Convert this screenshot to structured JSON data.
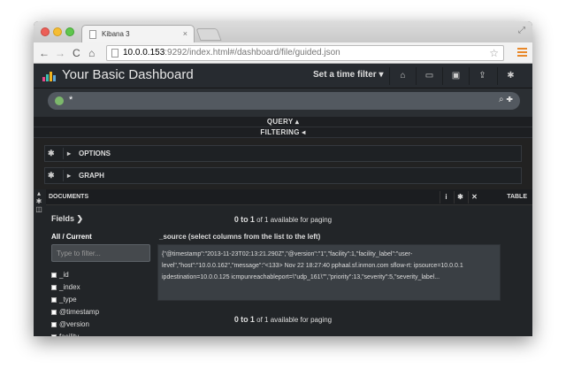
{
  "browser": {
    "tab_title": "Kibana 3",
    "tab_close": "×",
    "url_host": "10.0.0.153",
    "url_rest": ":9292/index.html#/dashboard/file/guided.json",
    "nav_back": "←",
    "nav_forward": "→",
    "nav_reload": "C",
    "nav_home": "⌂",
    "star": "☆",
    "resize": "⤢"
  },
  "navbar": {
    "title": "Your Basic Dashboard",
    "time_filter": "Set a time filter ▾",
    "icons": [
      "home-icon",
      "folder-open-icon",
      "save-icon",
      "share-icon",
      "settings-icon"
    ],
    "icon_glyphs": [
      "⌂",
      "▭",
      "▣",
      "⇪",
      "✱"
    ]
  },
  "query": {
    "value": "*",
    "actions": "⌕ ✚"
  },
  "strips": {
    "query_label": "QUERY ▴",
    "filtering_label": "FILTERING ◂"
  },
  "rows": [
    {
      "label": "OPTIONS",
      "gear": "✱",
      "caret": "▸"
    },
    {
      "label": "GRAPH",
      "gear": "✱",
      "caret": "▸"
    }
  ],
  "documents": {
    "title": "DOCUMENTS",
    "info_glyph": "i",
    "gear_glyph": "✱",
    "close_glyph": "✕",
    "table_label": "TABLE",
    "side_icons": [
      "▴",
      "✱",
      "◫"
    ],
    "fields_title": "Fields ❯",
    "paging_range_from": "0",
    "paging_to_word": "to",
    "paging_range_to": "1",
    "paging_rest": "of 1 available for paging",
    "all_current": "All / Current",
    "filter_placeholder": "Type to filter...",
    "fields": [
      "_id",
      "_index",
      "_type",
      "@timestamp",
      "@version",
      "facility"
    ],
    "source_label": "_source (select columns from the list to the left)",
    "source_text": "{\"@timestamp\":\"2013-11-23T02:13:21.290Z\",\"@version\":\"1\",\"facility\":1,\"facility_label\":\"user-level\",\"host\":\"10.0.0.162\",\"message\":\"<133> Nov 22 18:27:40 pphaal.sf.inmon.com sflow-rt: ipsource=10.0.0.1 ipdestination=10.0.0.125 icmpunreachableport=\\\"udp_161\\\"\",\"priority\":13,\"severity\":5,\"severity_label..."
  },
  "colors": {
    "panel_bg": "#272b30",
    "query_dot": "#7cb86b",
    "menu_accent": "#e8882a"
  }
}
